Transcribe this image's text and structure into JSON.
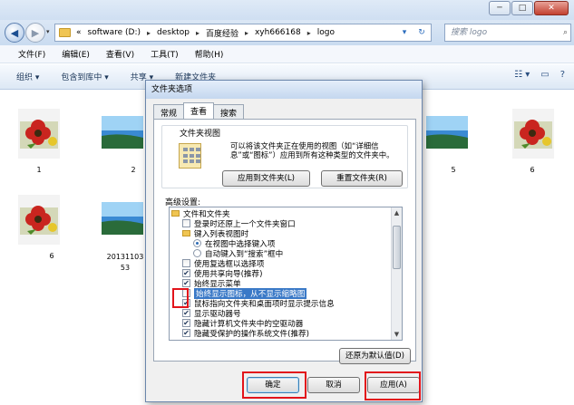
{
  "explorer": {
    "window_buttons": {
      "minimize": "─",
      "maximize": "□",
      "close": "✕"
    },
    "nav": {
      "back": "◀",
      "forward": "▶",
      "dropdown": "▾"
    },
    "breadcrumb": [
      "«",
      "software (D:)",
      "desktop",
      "百度经验",
      "xyh666168",
      "logo"
    ],
    "crumb_sep": "▸",
    "address_controls": {
      "dropdown": "▾",
      "refresh": "↻"
    },
    "search_placeholder": "搜索 logo",
    "search_glyph": "⌕",
    "menu": [
      "文件(F)",
      "编辑(E)",
      "查看(V)",
      "工具(T)",
      "帮助(H)"
    ],
    "toolbar": [
      "组织 ▾",
      "包含到库中 ▾",
      "共享 ▾",
      "新建文件夹"
    ],
    "toolbar_right": [
      "☷ ▾",
      "▭",
      "?"
    ],
    "files": [
      "1",
      "2",
      "5",
      "6",
      "6",
      "20131103\n53"
    ]
  },
  "dialog": {
    "title": "文件夹选项",
    "tabs": [
      "常规",
      "查看",
      "搜索"
    ],
    "active_tab": "查看",
    "views_group": {
      "title": "文件夹视图",
      "description": "可以将该文件夹正在使用的视图（如“详细信息”或“图标”）应用到所有这种类型的文件夹中。",
      "apply_button": "应用到文件夹(L)",
      "reset_button": "重置文件夹(R)"
    },
    "advanced_label": "高级设置:",
    "advanced_items": [
      {
        "type": "folder",
        "label": "文件和文件夹",
        "indent": 0
      },
      {
        "type": "checkbox",
        "label": "登录时还原上一个文件夹窗口",
        "checked": false,
        "indent": 1
      },
      {
        "type": "folder",
        "label": "键入列表视图时",
        "indent": 1
      },
      {
        "type": "radio",
        "label": "在视图中选择键入项",
        "checked": true,
        "indent": 2
      },
      {
        "type": "radio",
        "label": "自动键入到“搜索”框中",
        "checked": false,
        "indent": 2
      },
      {
        "type": "checkbox",
        "label": "使用复选框以选择项",
        "checked": false,
        "indent": 1
      },
      {
        "type": "checkbox",
        "label": "使用共享向导(推荐)",
        "checked": true,
        "indent": 1
      },
      {
        "type": "checkbox",
        "label": "始终显示菜单",
        "checked": true,
        "indent": 1
      },
      {
        "type": "checkbox",
        "label": "始终显示图标，从不显示缩略图",
        "checked": false,
        "indent": 1,
        "highlighted": true
      },
      {
        "type": "checkbox",
        "label": "鼠标指向文件夹和桌面项时显示提示信息",
        "checked": true,
        "indent": 1
      },
      {
        "type": "checkbox",
        "label": "显示驱动器号",
        "checked": true,
        "indent": 1
      },
      {
        "type": "checkbox",
        "label": "隐藏计算机文件夹中的空驱动器",
        "checked": true,
        "indent": 1
      },
      {
        "type": "checkbox",
        "label": "隐藏受保护的操作系统文件(推荐)",
        "checked": true,
        "indent": 1
      }
    ],
    "restore_button": "还原为默认值(D)",
    "ok_button": "确定",
    "cancel_button": "取消",
    "apply_button": "应用(A)",
    "check_glyph": "✔",
    "scroll_up": "▲",
    "scroll_down": "▼"
  },
  "colors": {
    "accent": "#3a79c7",
    "annotation_red": "#e2141b"
  }
}
